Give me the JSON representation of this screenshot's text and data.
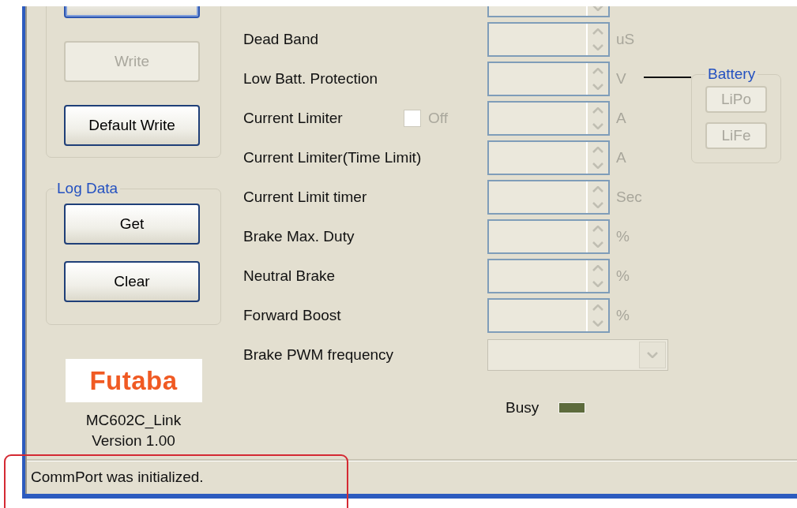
{
  "setup_group": {
    "buttons": [
      {
        "disabled": false,
        "focused": true
      },
      {
        "label": "Write",
        "disabled": true,
        "focused": false
      },
      {
        "label": "Default Write",
        "disabled": false,
        "focused": false
      }
    ]
  },
  "log_data": {
    "title": "Log Data",
    "buttons": [
      {
        "label": "Get",
        "disabled": false
      },
      {
        "label": "Clear",
        "disabled": false
      }
    ]
  },
  "logo": {
    "text": "Futaba"
  },
  "app_name": "MC602C_Link",
  "version": "Version 1.00",
  "settings": [
    {
      "kind": "spin"
    },
    {
      "kind": "spin",
      "label": "Dead Band",
      "unit": "uS"
    },
    {
      "kind": "spin",
      "label": "Low Batt. Protection",
      "unit": "V"
    },
    {
      "kind": "spin",
      "label": "Current Limiter",
      "unit": "A",
      "checkbox": {
        "label": "Off",
        "checked": false,
        "disabled": true
      }
    },
    {
      "kind": "spin",
      "label": "Current Limiter(Time Limit)",
      "unit": "A"
    },
    {
      "kind": "spin",
      "label": "Current Limit timer",
      "unit": "Sec"
    },
    {
      "kind": "spin",
      "label": "Brake Max. Duty",
      "unit": "%"
    },
    {
      "kind": "spin",
      "label": "Neutral Brake",
      "unit": "%"
    },
    {
      "kind": "spin",
      "label": "Forward Boost",
      "unit": "%"
    },
    {
      "kind": "dropdown",
      "label": "Brake PWM frequency"
    }
  ],
  "battery": {
    "title": "Battery",
    "buttons": [
      {
        "label": "LiPo",
        "disabled": true
      },
      {
        "label": "LiFe",
        "disabled": true
      }
    ]
  },
  "busy": {
    "label": "Busy",
    "on": false
  },
  "status_bar": {
    "text": "CommPort was initialized."
  }
}
